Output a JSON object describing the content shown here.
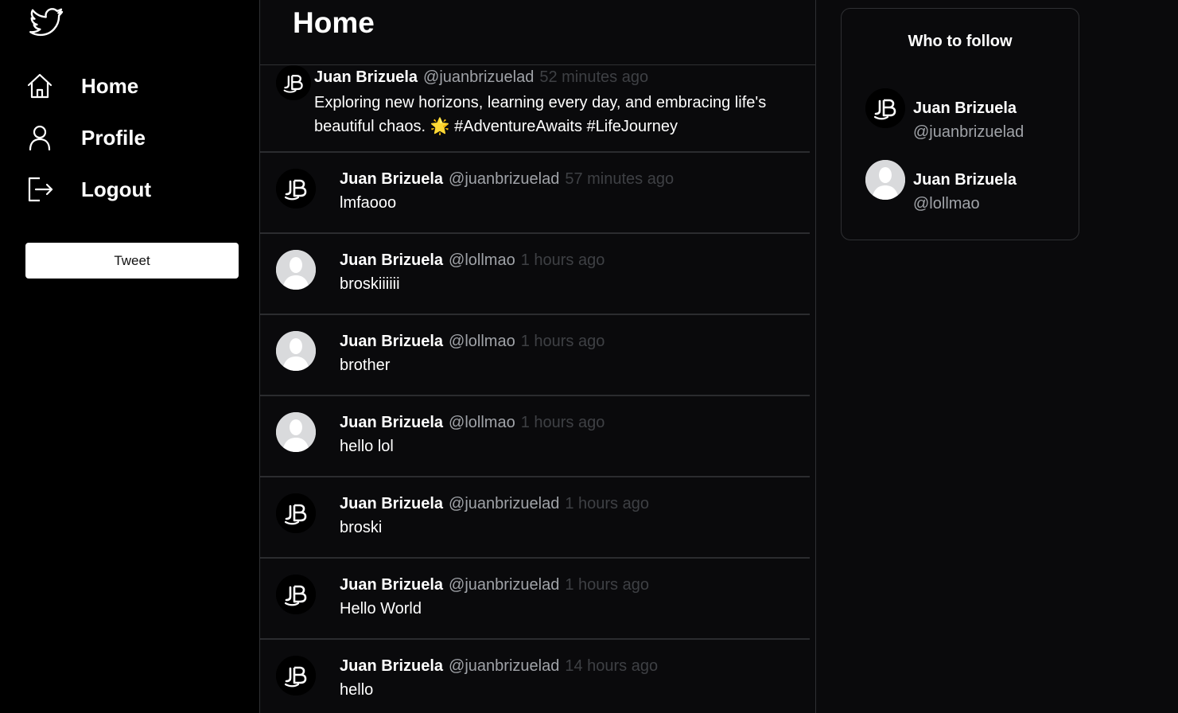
{
  "sidebar": {
    "logo_icon": "twitter-bird-icon",
    "nav": [
      {
        "label": "Home",
        "icon": "home-icon"
      },
      {
        "label": "Profile",
        "icon": "user-icon"
      },
      {
        "label": "Logout",
        "icon": "logout-icon"
      }
    ],
    "tweet_button_label": "Tweet"
  },
  "feed": {
    "title": "Home",
    "tweets": [
      {
        "author": "Juan Brizuela",
        "handle": "@juanbrizuelad",
        "time": "52 minutes ago",
        "text": "Exploring new horizons, learning every day, and embracing life's beautiful chaos. 🌟 #AdventureAwaits #LifeJourney",
        "avatar": "jb-logo-avatar"
      },
      {
        "author": "Juan Brizuela",
        "handle": "@juanbrizuelad",
        "time": "57 minutes ago",
        "text": "lmfaooo",
        "avatar": "jb-logo-avatar"
      },
      {
        "author": "Juan Brizuela",
        "handle": "@lollmao",
        "time": "1 hours ago",
        "text": "broskiiiiii",
        "avatar": "default-avatar"
      },
      {
        "author": "Juan Brizuela",
        "handle": "@lollmao",
        "time": "1 hours ago",
        "text": "brother",
        "avatar": "default-avatar"
      },
      {
        "author": "Juan Brizuela",
        "handle": "@lollmao",
        "time": "1 hours ago",
        "text": "hello lol",
        "avatar": "default-avatar"
      },
      {
        "author": "Juan Brizuela",
        "handle": "@juanbrizuelad",
        "time": "1 hours ago",
        "text": "broski",
        "avatar": "jb-logo-avatar"
      },
      {
        "author": "Juan Brizuela",
        "handle": "@juanbrizuelad",
        "time": "1 hours ago",
        "text": "Hello World",
        "avatar": "jb-logo-avatar"
      },
      {
        "author": "Juan Brizuela",
        "handle": "@juanbrizuelad",
        "time": "14 hours ago",
        "text": "hello",
        "avatar": "jb-logo-avatar"
      }
    ]
  },
  "who_to_follow": {
    "title": "Who to follow",
    "users": [
      {
        "name": "Juan Brizuela",
        "handle": "@juanbrizuelad",
        "avatar": "jb-logo-avatar"
      },
      {
        "name": "Juan Brizuela",
        "handle": "@lollmao",
        "avatar": "default-avatar"
      }
    ]
  },
  "colors": {
    "background": "#0a0a0c",
    "sidebar": "#000000",
    "divider": "#2f3033",
    "handle_text": "#a0a3a8",
    "time_text": "#3e4044",
    "tweet_button_bg": "#ffffff"
  }
}
